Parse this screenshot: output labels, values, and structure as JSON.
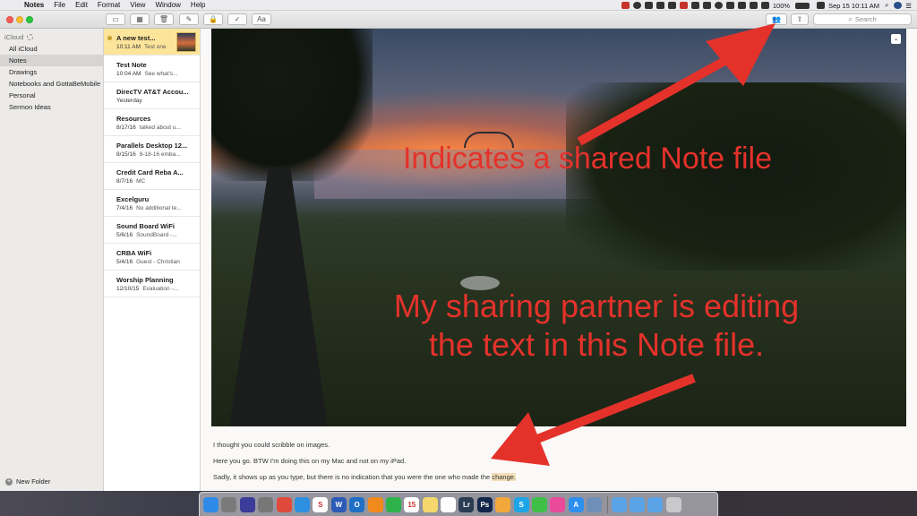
{
  "menubar": {
    "app": "Notes",
    "items": [
      "File",
      "Edit",
      "Format",
      "View",
      "Window",
      "Help"
    ],
    "battery_text": "100%",
    "datetime": "Sep 15  10:11 AM"
  },
  "toolbar": {
    "search_placeholder": "Search",
    "format_label": "Aa"
  },
  "sidebar": {
    "account": "iCloud",
    "folders": [
      "All iCloud",
      "Notes",
      "Drawings",
      "Notebooks and GottaBeMobile",
      "Personal",
      "Sermon Ideas"
    ],
    "new_folder": "New Folder"
  },
  "notes": [
    {
      "title": "A new test...",
      "date": "10:11 AM",
      "preview": "Test one"
    },
    {
      "title": "Test Note",
      "date": "10:04 AM",
      "preview": "See what's..."
    },
    {
      "title": "DirecTV AT&T Accou...",
      "date": "Yesterday",
      "preview": ""
    },
    {
      "title": "Resources",
      "date": "8/17/16",
      "preview": "talked about u..."
    },
    {
      "title": "Parallels Desktop 12...",
      "date": "8/15/16",
      "preview": "8-18-16 emba..."
    },
    {
      "title": "Credit Card Reba A...",
      "date": "8/7/16",
      "preview": "MC"
    },
    {
      "title": "Excelguru",
      "date": "7/4/16",
      "preview": "No additional te..."
    },
    {
      "title": "Sound Board WiFi",
      "date": "5/6/16",
      "preview": "SoundBoard -..."
    },
    {
      "title": "CRBA WiFi",
      "date": "5/4/16",
      "preview": "Guest - Christian"
    },
    {
      "title": "Worship Planning",
      "date": "12/10/15",
      "preview": "Evaluation -..."
    }
  ],
  "editor": {
    "annotation_1": "Indicates a shared Note file",
    "annotation_2_line1": "My sharing partner is editing",
    "annotation_2_line2": "the text in this Note file.",
    "line1": "I thought you could scribble on images.",
    "line2": "Here you go. BTW I'm doing this on my Mac and not on my iPad.",
    "line3_pre": "Sadly, it shows up as you type, but there is no indication that you were the one who made the ",
    "line3_highlight": "change."
  },
  "dock": {
    "icons": [
      {
        "name": "finder-icon",
        "color": "#2e8ae6",
        "glyph": ""
      },
      {
        "name": "launchpad-icon",
        "color": "#7a7a7a",
        "glyph": ""
      },
      {
        "name": "siri-icon",
        "color": "#3b3b9a",
        "glyph": ""
      },
      {
        "name": "rocket-icon",
        "color": "#777",
        "glyph": ""
      },
      {
        "name": "chrome-icon",
        "color": "#e04a3a",
        "glyph": ""
      },
      {
        "name": "safari-icon",
        "color": "#2d8fe0",
        "glyph": ""
      },
      {
        "name": "slack-icon",
        "color": "#fff",
        "glyph": "S"
      },
      {
        "name": "word-icon",
        "color": "#2b5bb7",
        "glyph": "W"
      },
      {
        "name": "outlook-icon",
        "color": "#1f6fc6",
        "glyph": "O"
      },
      {
        "name": "vlc-icon",
        "color": "#f08a1c",
        "glyph": ""
      },
      {
        "name": "evernote-icon",
        "color": "#2eb24a",
        "glyph": ""
      },
      {
        "name": "calendar-icon",
        "color": "#fff",
        "glyph": "15"
      },
      {
        "name": "notes-icon",
        "color": "#f5d76b",
        "glyph": ""
      },
      {
        "name": "reminders-icon",
        "color": "#fff",
        "glyph": ""
      },
      {
        "name": "lightroom-icon",
        "color": "#2a3b52",
        "glyph": "Lr"
      },
      {
        "name": "photoshop-icon",
        "color": "#11264a",
        "glyph": "Ps"
      },
      {
        "name": "photos-icon",
        "color": "#f2a83b",
        "glyph": ""
      },
      {
        "name": "skype-icon",
        "color": "#1ea5e8",
        "glyph": "S"
      },
      {
        "name": "messages-icon",
        "color": "#3fbf48",
        "glyph": ""
      },
      {
        "name": "itunes-icon",
        "color": "#e94a9a",
        "glyph": ""
      },
      {
        "name": "app-store-icon",
        "color": "#2d8ff0",
        "glyph": "A"
      },
      {
        "name": "preview-icon",
        "color": "#6e8fb8",
        "glyph": ""
      }
    ],
    "right_icons": [
      {
        "name": "folder-icon",
        "color": "#5aa3e6"
      },
      {
        "name": "downloads-folder-icon",
        "color": "#5aa3e6"
      },
      {
        "name": "documents-folder-icon",
        "color": "#5aa3e6"
      },
      {
        "name": "trash-icon",
        "color": "#c9c9cc"
      }
    ]
  }
}
